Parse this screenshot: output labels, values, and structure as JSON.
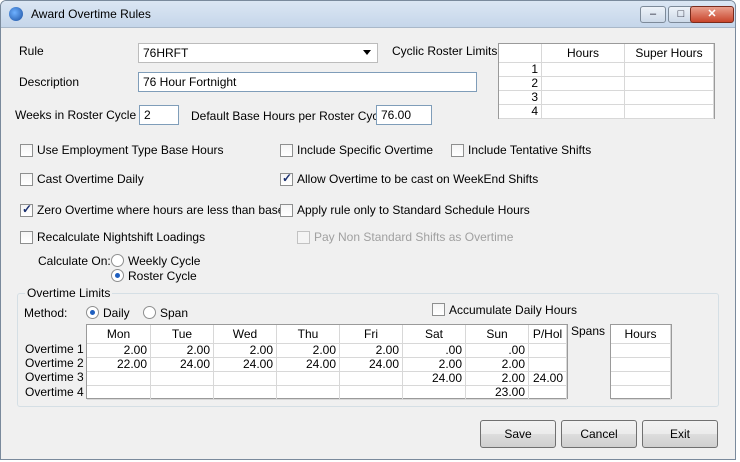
{
  "window": {
    "title": "Award Overtime Rules",
    "controls": {
      "minimize": "–",
      "maximize": "□",
      "close": "✕"
    }
  },
  "form": {
    "rule_label": "Rule",
    "rule_value": "76HRFT",
    "description_label": "Description",
    "description_value": "76 Hour Fortnight",
    "weeks_label": "Weeks in Roster Cycle",
    "weeks_value": "2",
    "base_hours_label": "Default Base Hours per Roster Cycle",
    "base_hours_value": "76.00",
    "cyclic_label": "Cyclic Roster Limits"
  },
  "cyclic_grid": {
    "headers": [
      "",
      "Hours",
      "Super Hours"
    ],
    "rows": [
      [
        "1",
        "",
        ""
      ],
      [
        "2",
        "",
        ""
      ],
      [
        "3",
        "",
        ""
      ],
      [
        "4",
        "",
        ""
      ]
    ]
  },
  "options": {
    "use_employment": "Use Employment Type Base Hours",
    "include_specific": "Include Specific Overtime",
    "include_tentative": "Include Tentative Shifts",
    "cast_daily": "Cast Overtime Daily",
    "allow_weekend": "Allow Overtime to be cast on WeekEnd Shifts",
    "zero_overtime": "Zero Overtime where hours are less than base",
    "apply_standard": "Apply rule only to Standard Schedule Hours",
    "recalc_night": "Recalculate Nightshift Loadings",
    "pay_nonstandard": "Pay Non Standard Shifts as Overtime"
  },
  "calculate": {
    "label": "Calculate On:",
    "weekly": "Weekly Cycle",
    "roster": "Roster Cycle"
  },
  "overtime": {
    "group_label": "Overtime Limits",
    "method_label": "Method:",
    "daily": "Daily",
    "span": "Span",
    "accumulate": "Accumulate Daily Hours",
    "spans_label": "Spans",
    "spans_header": "Hours",
    "headers": [
      "",
      "Mon",
      "Tue",
      "Wed",
      "Thu",
      "Fri",
      "Sat",
      "Sun",
      "P/Hol"
    ],
    "rows": [
      [
        "Overtime 1",
        "2.00",
        "2.00",
        "2.00",
        "2.00",
        "2.00",
        ".00",
        ".00",
        ""
      ],
      [
        "Overtime 2",
        "22.00",
        "24.00",
        "24.00",
        "24.00",
        "24.00",
        "2.00",
        "2.00",
        ""
      ],
      [
        "Overtime 3",
        "",
        "",
        "",
        "",
        "",
        "24.00",
        "2.00",
        "24.00"
      ],
      [
        "Overtime 4",
        "",
        "",
        "",
        "",
        "",
        "",
        "23.00",
        ""
      ]
    ]
  },
  "buttons": {
    "save": "Save",
    "cancel": "Cancel",
    "exit": "Exit"
  }
}
